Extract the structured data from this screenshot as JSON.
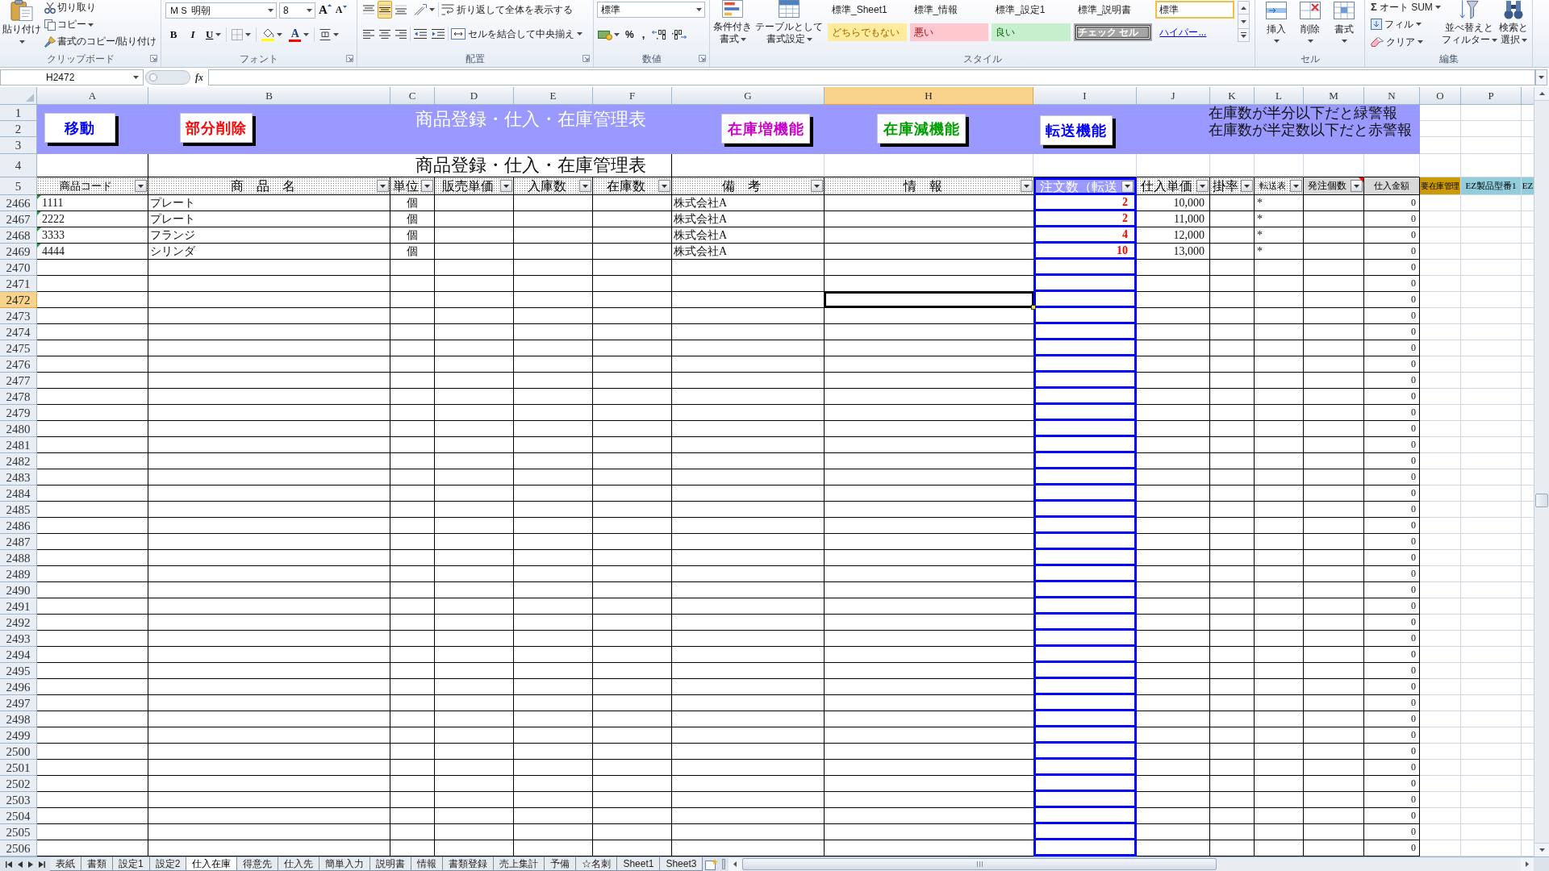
{
  "ribbon": {
    "clipboard": {
      "label": "クリップボード",
      "paste": "貼り付け",
      "cut": "切り取り",
      "copy": "コピー",
      "format_painter": "書式のコピー/貼り付け"
    },
    "font": {
      "label": "フォント",
      "font_name": "ＭＳ 明朝",
      "font_size": "8",
      "grow": "A",
      "shrink": "A",
      "bold": "B",
      "italic": "I",
      "underline": "U",
      "font_color": "A"
    },
    "alignment": {
      "label": "配置",
      "vertical": [
        {
          "kind": "top",
          "selected": false
        },
        {
          "kind": "middle",
          "selected": true
        },
        {
          "kind": "bottom",
          "selected": false
        }
      ],
      "wrap_text": "折り返して全体を表示する",
      "merge_center": "セルを結合して中央揃え"
    },
    "number": {
      "label": "数値",
      "format": "標準",
      "percent": "%",
      "comma": ","
    },
    "styles": {
      "label": "スタイル",
      "conditional": [
        "条件付き",
        "書式"
      ],
      "format_table": [
        "テーブルとして",
        "書式設定"
      ],
      "gallery": [
        {
          "label": "標準_Sheet1",
          "kind": "normal",
          "selected": false
        },
        {
          "label": "標準_情報",
          "kind": "normal",
          "selected": false
        },
        {
          "label": "標準_設定1",
          "kind": "normal",
          "selected": false
        },
        {
          "label": "標準_説明書",
          "kind": "normal",
          "selected": false
        },
        {
          "label": "標準",
          "kind": "normal",
          "selected": true
        },
        {
          "label": "どちらでもない",
          "kind": "neutral",
          "selected": false
        },
        {
          "label": "悪い",
          "kind": "bad",
          "selected": false
        },
        {
          "label": "良い",
          "kind": "good",
          "selected": false
        },
        {
          "label": "チェック セル",
          "kind": "check",
          "selected": false
        },
        {
          "label": "ハイパー...",
          "kind": "link",
          "selected": false
        }
      ]
    },
    "cells": {
      "label": "セル",
      "buttons": [
        {
          "label": "挿入",
          "kind": "insert"
        },
        {
          "label": "削除",
          "kind": "delete"
        },
        {
          "label": "書式",
          "kind": "format"
        }
      ]
    },
    "editing": {
      "label": "編集",
      "autosum_symbol": "Σ",
      "autosum": "オート SUM",
      "fill": "フィル",
      "clear": "クリア",
      "sort_filter": [
        "並べ替えと",
        "フィルター"
      ],
      "find_select": [
        "検索と",
        "選択"
      ]
    }
  },
  "formula_bar": {
    "name_box": "H2472",
    "function_label": "fx"
  },
  "columns": [
    {
      "label": "A",
      "selected": false
    },
    {
      "label": "B",
      "selected": false
    },
    {
      "label": "C",
      "selected": false
    },
    {
      "label": "D",
      "selected": false
    },
    {
      "label": "E",
      "selected": false
    },
    {
      "label": "F",
      "selected": false
    },
    {
      "label": "G",
      "selected": false
    },
    {
      "label": "H",
      "selected": true
    },
    {
      "label": "I",
      "selected": false
    },
    {
      "label": "J",
      "selected": false
    },
    {
      "label": "K",
      "selected": false
    },
    {
      "label": "L",
      "selected": false
    },
    {
      "label": "M",
      "selected": false
    },
    {
      "label": "N",
      "selected": false
    },
    {
      "label": "O",
      "selected": false
    },
    {
      "label": "P",
      "selected": false
    }
  ],
  "banner": {
    "row_numbers": [
      "1",
      "2",
      "3"
    ],
    "title": "商品登録・仕入・在庫管理表",
    "buttons": [
      {
        "label": "移動",
        "color": "#0000ff"
      },
      {
        "label": "部分削除",
        "color": "#ff0000"
      },
      {
        "label": "在庫増機能",
        "color": "#cc00cc"
      },
      {
        "label": "在庫減機能",
        "color": "#00a000"
      },
      {
        "label": "転送機能",
        "color": "#0000ff"
      }
    ],
    "notes": [
      "在庫数が半分以下だと緑警報",
      "在庫数が半定数以下だと赤警報"
    ]
  },
  "title_row": {
    "number": "4",
    "title": "商品登録・仕入・在庫管理表"
  },
  "header_row": {
    "number": "5",
    "cells": [
      {
        "label": "商品コード",
        "kind": "pattern",
        "filter": true,
        "comment": false
      },
      {
        "label": "商　品　名",
        "kind": "pattern",
        "filter": true,
        "comment": false
      },
      {
        "label": "単位",
        "kind": "pattern",
        "filter": true,
        "comment": false
      },
      {
        "label": "販売単価",
        "kind": "pattern",
        "filter": true,
        "comment": false
      },
      {
        "label": "入庫数",
        "kind": "pattern",
        "filter": true,
        "comment": false
      },
      {
        "label": "在庫数",
        "kind": "pattern",
        "filter": true,
        "comment": false
      },
      {
        "label": "備　考",
        "kind": "pattern",
        "filter": true,
        "comment": false
      },
      {
        "label": "情　報",
        "kind": "pattern",
        "filter": true,
        "comment": false
      },
      {
        "label": "注文数（転送",
        "kind": "accent",
        "filter": true,
        "comment": false
      },
      {
        "label": "仕入単価",
        "kind": "pattern",
        "filter": true,
        "comment": false
      },
      {
        "label": "掛率",
        "kind": "pattern",
        "filter": true,
        "comment": false
      },
      {
        "label": "転送表",
        "kind": "pattern",
        "filter": true,
        "comment": false
      },
      {
        "label": "発注個数",
        "kind": "gray",
        "filter": true,
        "comment": true
      },
      {
        "label": "仕入金額",
        "kind": "gray",
        "filter": false,
        "comment": false
      },
      {
        "label": "要在庫管理",
        "kind": "gold",
        "filter": false,
        "comment": false
      },
      {
        "label": "EZ製品型番1",
        "kind": "cyan",
        "filter": false,
        "comment": false
      },
      {
        "label": "EZ",
        "kind": "cyan",
        "filter": false,
        "comment": false
      }
    ]
  },
  "rows": [
    {
      "number": "2466",
      "selected": false,
      "flagged": true,
      "code": "1111",
      "name": "プレート",
      "unit": "個",
      "note": "株式会社A",
      "order_qty": "2",
      "unit_price": "10,000",
      "transfer": "*",
      "amount": "0"
    },
    {
      "number": "2467",
      "selected": false,
      "flagged": true,
      "code": "2222",
      "name": "プレート",
      "unit": "個",
      "note": "株式会社A",
      "order_qty": "2",
      "unit_price": "11,000",
      "transfer": "*",
      "amount": "0"
    },
    {
      "number": "2468",
      "selected": false,
      "flagged": true,
      "code": "3333",
      "name": "フランジ",
      "unit": "個",
      "note": "株式会社A",
      "order_qty": "4",
      "unit_price": "12,000",
      "transfer": "*",
      "amount": "0"
    },
    {
      "number": "2469",
      "selected": false,
      "flagged": true,
      "code": "4444",
      "name": "シリンダ",
      "unit": "個",
      "note": "株式会社A",
      "order_qty": "10",
      "unit_price": "13,000",
      "transfer": "*",
      "amount": "0"
    },
    {
      "number": "2470",
      "selected": false,
      "flagged": false,
      "amount": "0"
    },
    {
      "number": "2471",
      "selected": false,
      "flagged": false,
      "amount": "0"
    },
    {
      "number": "2472",
      "selected": true,
      "flagged": false,
      "amount": "0"
    },
    {
      "number": "2473",
      "selected": false,
      "flagged": false,
      "amount": "0"
    },
    {
      "number": "2474",
      "selected": false,
      "flagged": false,
      "amount": "0"
    },
    {
      "number": "2475",
      "selected": false,
      "flagged": false,
      "amount": "0"
    },
    {
      "number": "2476",
      "selected": false,
      "flagged": false,
      "amount": "0"
    },
    {
      "number": "2477",
      "selected": false,
      "flagged": false,
      "amount": "0"
    },
    {
      "number": "2478",
      "selected": false,
      "flagged": false,
      "amount": "0"
    },
    {
      "number": "2479",
      "selected": false,
      "flagged": false,
      "amount": "0"
    },
    {
      "number": "2480",
      "selected": false,
      "flagged": false,
      "amount": "0"
    },
    {
      "number": "2481",
      "selected": false,
      "flagged": false,
      "amount": "0"
    },
    {
      "number": "2482",
      "selected": false,
      "flagged": false,
      "amount": "0"
    },
    {
      "number": "2483",
      "selected": false,
      "flagged": false,
      "amount": "0"
    },
    {
      "number": "2484",
      "selected": false,
      "flagged": false,
      "amount": "0"
    },
    {
      "number": "2485",
      "selected": false,
      "flagged": false,
      "amount": "0"
    },
    {
      "number": "2486",
      "selected": false,
      "flagged": false,
      "amount": "0"
    },
    {
      "number": "2487",
      "selected": false,
      "flagged": false,
      "amount": "0"
    },
    {
      "number": "2488",
      "selected": false,
      "flagged": false,
      "amount": "0"
    },
    {
      "number": "2489",
      "selected": false,
      "flagged": false,
      "amount": "0"
    },
    {
      "number": "2490",
      "selected": false,
      "flagged": false,
      "amount": "0"
    },
    {
      "number": "2491",
      "selected": false,
      "flagged": false,
      "amount": "0"
    },
    {
      "number": "2492",
      "selected": false,
      "flagged": false,
      "amount": "0"
    },
    {
      "number": "2493",
      "selected": false,
      "flagged": false,
      "amount": "0"
    },
    {
      "number": "2494",
      "selected": false,
      "flagged": false,
      "amount": "0"
    },
    {
      "number": "2495",
      "selected": false,
      "flagged": false,
      "amount": "0"
    },
    {
      "number": "2496",
      "selected": false,
      "flagged": false,
      "amount": "0"
    },
    {
      "number": "2497",
      "selected": false,
      "flagged": false,
      "amount": "0"
    },
    {
      "number": "2498",
      "selected": false,
      "flagged": false,
      "amount": "0"
    },
    {
      "number": "2499",
      "selected": false,
      "flagged": false,
      "amount": "0"
    },
    {
      "number": "2500",
      "selected": false,
      "flagged": false,
      "amount": "0"
    },
    {
      "number": "2501",
      "selected": false,
      "flagged": false,
      "amount": "0"
    },
    {
      "number": "2502",
      "selected": false,
      "flagged": false,
      "amount": "0"
    },
    {
      "number": "2503",
      "selected": false,
      "flagged": false,
      "amount": "0"
    },
    {
      "number": "2504",
      "selected": false,
      "flagged": false,
      "amount": "0"
    },
    {
      "number": "2505",
      "selected": false,
      "flagged": false,
      "amount": "0"
    },
    {
      "number": "2506",
      "selected": false,
      "flagged": false,
      "amount": "0"
    }
  ],
  "sheet_tabs": [
    {
      "label": "表紙",
      "selected": false
    },
    {
      "label": "書類",
      "selected": false
    },
    {
      "label": "設定1",
      "selected": false
    },
    {
      "label": "設定2",
      "selected": false
    },
    {
      "label": "仕入在庫",
      "selected": true
    },
    {
      "label": "得意先",
      "selected": false
    },
    {
      "label": "仕入先",
      "selected": false
    },
    {
      "label": "簡単入力",
      "selected": false
    },
    {
      "label": "説明書",
      "selected": false
    },
    {
      "label": "情報",
      "selected": false
    },
    {
      "label": "書類登録",
      "selected": false
    },
    {
      "label": "売上集計",
      "selected": false
    },
    {
      "label": "予備",
      "selected": false
    },
    {
      "label": "☆名刺",
      "selected": false
    },
    {
      "label": "Sheet1",
      "selected": false
    },
    {
      "label": "Sheet3",
      "selected": false
    }
  ]
}
